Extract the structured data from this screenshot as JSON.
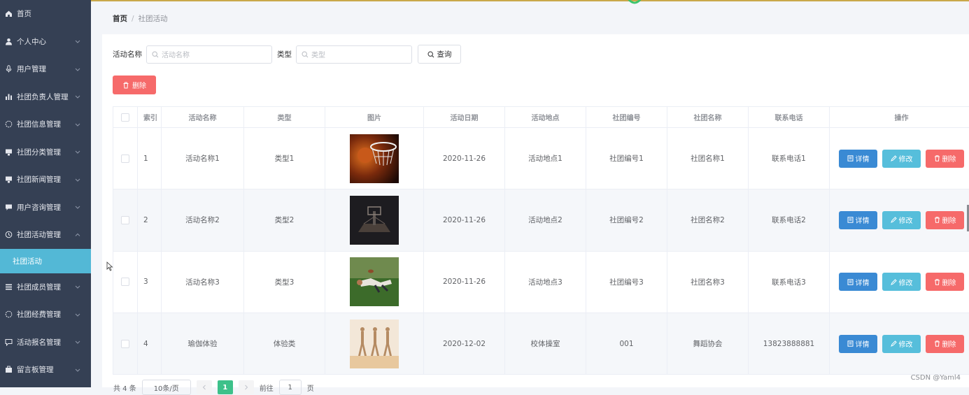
{
  "sidebar": {
    "items": [
      {
        "label": "首页",
        "icon": "home-icon",
        "expandable": false
      },
      {
        "label": "个人中心",
        "icon": "user-icon",
        "expandable": true
      },
      {
        "label": "用户管理",
        "icon": "microphone-icon",
        "expandable": true
      },
      {
        "label": "社团负责人管理",
        "icon": "bar-chart-icon",
        "expandable": true
      },
      {
        "label": "社团信息管理",
        "icon": "circle-icon",
        "expandable": true
      },
      {
        "label": "社团分类管理",
        "icon": "monitor-icon",
        "expandable": true
      },
      {
        "label": "社团新闻管理",
        "icon": "monitor-icon",
        "expandable": true
      },
      {
        "label": "用户咨询管理",
        "icon": "chat-icon",
        "expandable": true
      },
      {
        "label": "社团活动管理",
        "icon": "clock-icon",
        "expandable": true,
        "expanded": true
      },
      {
        "label": "社团活动",
        "icon": "",
        "sub": true,
        "active": true
      },
      {
        "label": "社团成员管理",
        "icon": "list-icon",
        "expandable": true
      },
      {
        "label": "社团经费管理",
        "icon": "circle-icon",
        "expandable": true
      },
      {
        "label": "活动报名管理",
        "icon": "message-icon",
        "expandable": true
      },
      {
        "label": "留言板管理",
        "icon": "briefcase-icon",
        "expandable": true
      }
    ]
  },
  "breadcrumb": {
    "home": "首页",
    "separator": "/",
    "current": "社团活动"
  },
  "search": {
    "name_label": "活动名称",
    "name_placeholder": "活动名称",
    "type_label": "类型",
    "type_placeholder": "类型",
    "query_label": "查询"
  },
  "actions": {
    "delete_label": "删除"
  },
  "table": {
    "headers": [
      "索引",
      "活动名称",
      "类型",
      "图片",
      "活动日期",
      "活动地点",
      "社团编号",
      "社团名称",
      "联系电话",
      "操作"
    ],
    "rows": [
      {
        "index": "1",
        "name": "活动名称1",
        "type": "类型1",
        "image": "basketball-hoop-photo",
        "date": "2020-11-26",
        "location": "活动地点1",
        "club_no": "社团编号1",
        "club_name": "社团名称1",
        "phone": "联系电话1"
      },
      {
        "index": "2",
        "name": "活动名称2",
        "type": "类型2",
        "image": "basketball-court-night-photo",
        "date": "2020-11-26",
        "location": "活动地点2",
        "club_no": "社团编号2",
        "club_name": "社团名称2",
        "phone": "联系电话2"
      },
      {
        "index": "3",
        "name": "活动名称3",
        "type": "类型3",
        "image": "rugby-player-photo",
        "date": "2020-11-26",
        "location": "活动地点3",
        "club_no": "社团编号3",
        "club_name": "社团名称3",
        "phone": "联系电话3"
      },
      {
        "index": "4",
        "name": "瑜伽体验",
        "type": "体验类",
        "image": "yoga-class-photo",
        "date": "2020-12-02",
        "location": "校体操室",
        "club_no": "001",
        "club_name": "舞蹈协会",
        "phone": "13823888881"
      }
    ],
    "row_actions": {
      "detail": "详情",
      "edit": "修改",
      "delete": "删除"
    }
  },
  "pagination": {
    "total": "共 4 条",
    "page_size": "10条/页",
    "current_page": "1",
    "goto_label": "前往",
    "goto_value": "1",
    "page_unit": "页"
  },
  "watermark": "CSDN @Yaml4",
  "colors": {
    "sidebar_bg": "#354054",
    "active_item": "#53b8d6",
    "detail_btn": "#3a8ad4",
    "edit_btn": "#56bedb",
    "delete_btn": "#f66a6a",
    "current_page": "#3dc18a"
  }
}
